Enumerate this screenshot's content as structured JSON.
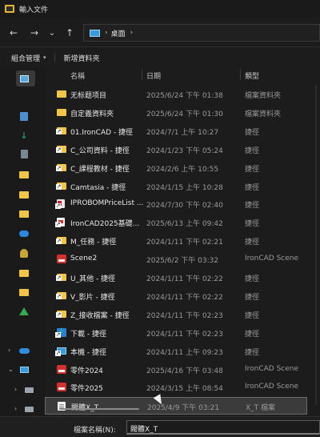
{
  "window": {
    "title": "輸入文件"
  },
  "nav": {
    "back": "←",
    "forward": "→",
    "history": "⌄",
    "up": "↑"
  },
  "address": {
    "chevron": "›",
    "location": "桌面",
    "chevron_end": "›"
  },
  "commands": {
    "organize": "組合管理",
    "organize_chevron": "▾",
    "new_folder": "新增資料夾"
  },
  "columns": {
    "name": "名稱",
    "date": "日期",
    "type": "類型"
  },
  "files": [
    {
      "icon": "folder",
      "name": "无标题项目",
      "date": "2025/6/24 下午 01:38",
      "type": "檔案資料夾"
    },
    {
      "icon": "folder",
      "name": "自定義資料夾",
      "date": "2025/6/24 下午 01:30",
      "type": "檔案資料夾"
    },
    {
      "icon": "shortcut",
      "name": "01.IronCAD - 捷徑",
      "date": "2024/7/1 上午 10:27",
      "type": "捷徑"
    },
    {
      "icon": "shortcut",
      "name": "C_公司資料 - 捷徑",
      "date": "2024/1/23 下午 05:24",
      "type": "捷徑"
    },
    {
      "icon": "shortcut",
      "name": "C_課程教材 - 捷徑",
      "date": "2024/2/6 上午 10:55",
      "type": "捷徑"
    },
    {
      "icon": "shortcut",
      "name": "Camtasia - 捷徑",
      "date": "2024/1/15 上午 10:28",
      "type": "捷徑"
    },
    {
      "icon": "xls",
      "name": "IPROBOMPriceList ...",
      "date": "2024/7/30 下午 02:40",
      "type": "捷徑"
    },
    {
      "icon": "pdf",
      "name": "IronCAD2025基礎...",
      "date": "2025/6/13 上午 09:42",
      "type": "捷徑"
    },
    {
      "icon": "shortcut",
      "name": "M_任務 - 捷徑",
      "date": "2024/1/11 下午 02:21",
      "type": "捷徑"
    },
    {
      "icon": "scene",
      "name": "Scene2",
      "date": "2025/6/2 下午 03:32",
      "type": "IronCAD Scene"
    },
    {
      "icon": "shortcut",
      "name": "U_其他 - 捷徑",
      "date": "2024/1/11 下午 02:22",
      "type": "捷徑"
    },
    {
      "icon": "shortcut",
      "name": "V_影片 - 捷徑",
      "date": "2024/1/11 下午 02:22",
      "type": "捷徑"
    },
    {
      "icon": "shortcut",
      "name": "Z_接收檔案 - 捷徑",
      "date": "2024/1/11 下午 02:23",
      "type": "捷徑"
    },
    {
      "icon": "download",
      "name": "下載 - 捷徑",
      "date": "2024/1/11 下午 02:23",
      "type": "捷徑"
    },
    {
      "icon": "pc",
      "name": "本機 - 捷徑",
      "date": "2024/1/11 上午 09:23",
      "type": "捷徑"
    },
    {
      "icon": "scene",
      "name": "零件2024",
      "date": "2025/4/16 下午 03:48",
      "type": "IronCAD Scene"
    },
    {
      "icon": "scene",
      "name": "零件2025",
      "date": "2024/3/15 上午 08:54",
      "type": "IronCAD Scene"
    },
    {
      "icon": "xt",
      "name": "閥體X_T",
      "date": "2025/4/9 下午 03:21",
      "type": "X_T 檔案",
      "selected": true
    }
  ],
  "footer": {
    "filename_label": "檔案名稱(N):",
    "filename_value": "閥體X_T"
  },
  "sidebar": {
    "expanders": [
      "›",
      "⌄",
      "›",
      "›"
    ]
  }
}
